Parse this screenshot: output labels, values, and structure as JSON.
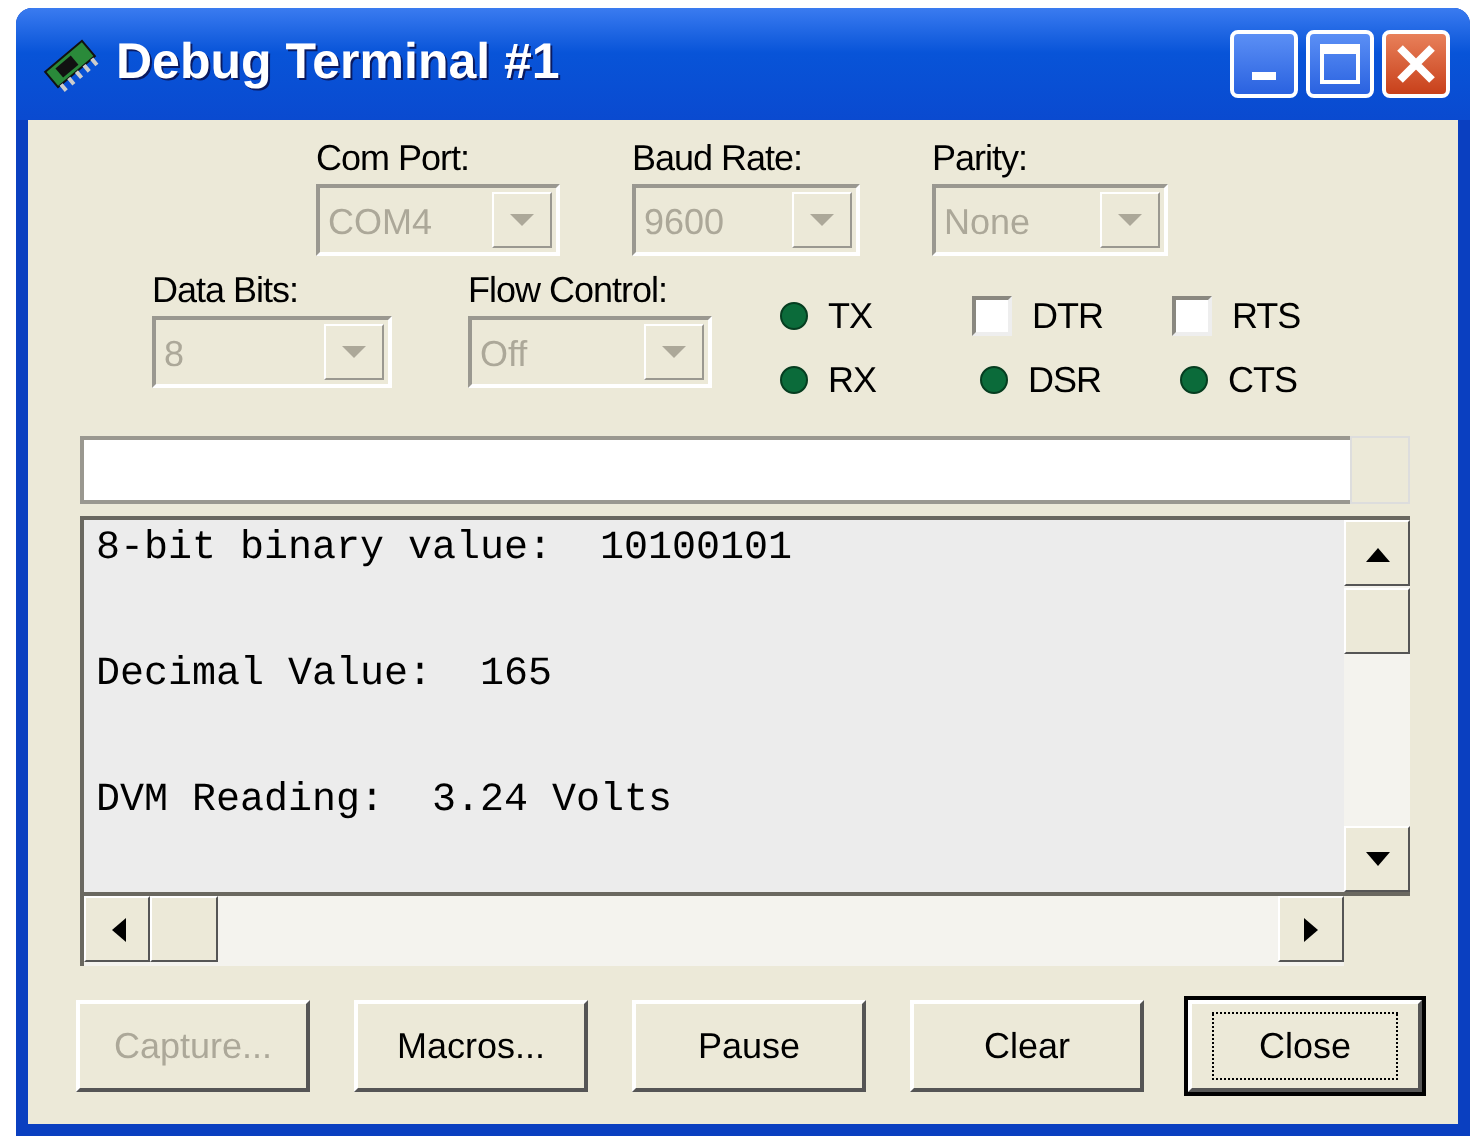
{
  "window": {
    "title": "Debug Terminal #1"
  },
  "settings_row_1": [
    {
      "label": "Com Port:",
      "value": "COM4",
      "disabled": true
    },
    {
      "label": "Baud Rate:",
      "value": "9600",
      "disabled": true
    },
    {
      "label": "Parity:",
      "value": "None",
      "disabled": true
    }
  ],
  "settings_row_2": [
    {
      "label": "Data Bits:",
      "value": "8",
      "disabled": true
    },
    {
      "label": "Flow Control:",
      "value": "Off",
      "disabled": true
    }
  ],
  "signals": [
    [
      {
        "kind": "led",
        "label": "TX"
      },
      {
        "kind": "checkbox",
        "label": "DTR",
        "checked": false
      },
      {
        "kind": "checkbox",
        "label": "RTS",
        "checked": false
      }
    ],
    [
      {
        "kind": "led",
        "label": "RX"
      },
      {
        "kind": "led",
        "label": "DSR"
      },
      {
        "kind": "led",
        "label": "CTS"
      }
    ]
  ],
  "terminal": {
    "lines": [
      "8-bit binary value:  10100101",
      "Decimal Value:  165",
      "DVM Reading:  3.24 Volts"
    ]
  },
  "buttons": [
    {
      "label": "Capture...",
      "disabled": true,
      "default": false
    },
    {
      "label": "Macros...",
      "disabled": false,
      "default": false
    },
    {
      "label": "Pause",
      "disabled": false,
      "default": false
    },
    {
      "label": "Clear",
      "disabled": false,
      "default": false
    },
    {
      "label": "Close",
      "disabled": false,
      "default": true
    }
  ]
}
